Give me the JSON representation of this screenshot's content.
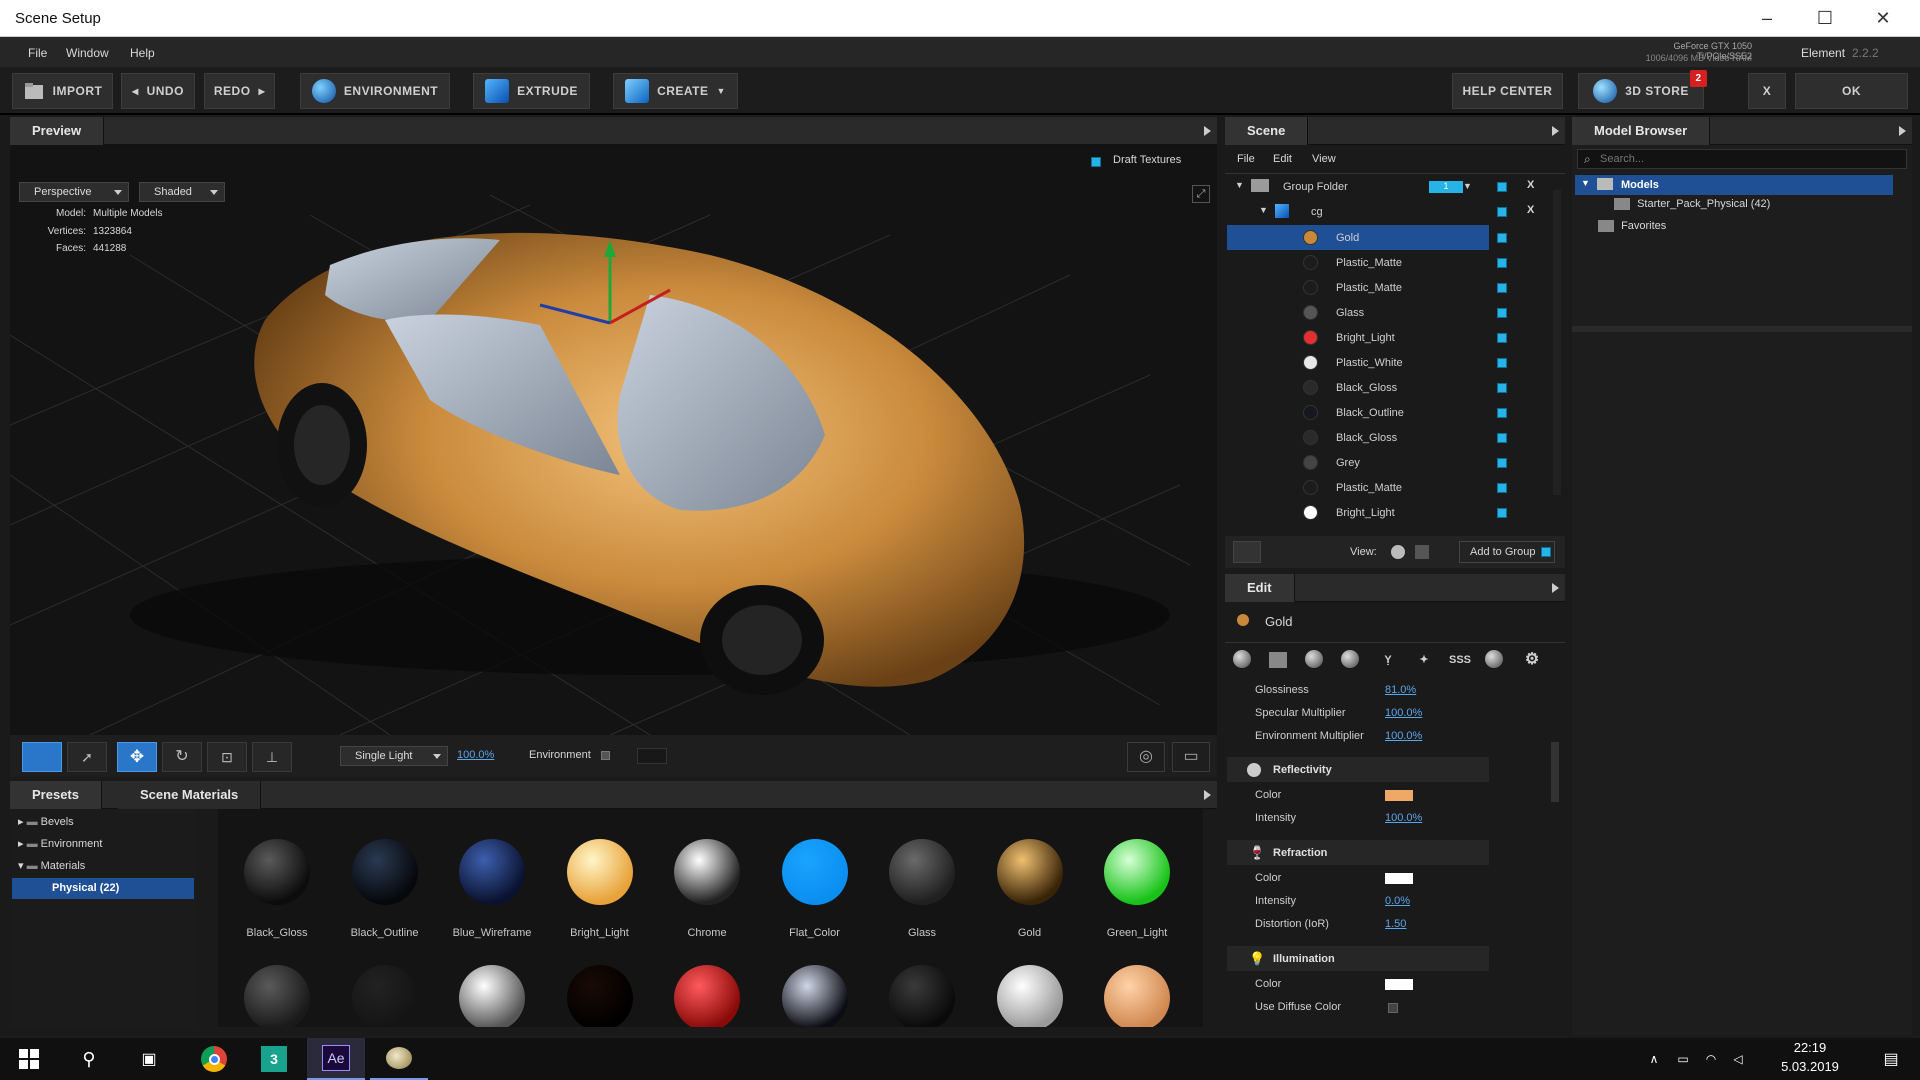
{
  "window": {
    "title": "Scene Setup"
  },
  "menu": {
    "file": "File",
    "window": "Window",
    "help": "Help",
    "gpu_line1": "GeForce GTX 1050 Ti/PCIe/SSE2",
    "gpu_line2": "1006/4096 MB Video RAM",
    "app_name": "Element",
    "app_version": "2.2.2"
  },
  "toolbar": {
    "import": "IMPORT",
    "undo": "UNDO",
    "redo": "REDO",
    "environment": "ENVIRONMENT",
    "extrude": "EXTRUDE",
    "create": "CREATE",
    "help_center": "HELP CENTER",
    "store": "3D STORE",
    "store_badge": "2",
    "close": "X",
    "ok": "OK"
  },
  "preview": {
    "title": "Preview",
    "draft_textures": "Draft Textures",
    "view_mode": "Perspective",
    "shading": "Shaded",
    "model_label": "Model:",
    "model_value": "Multiple Models",
    "vertices_label": "Vertices:",
    "vertices_value": "1323864",
    "faces_label": "Faces:",
    "faces_value": "441288",
    "light_mode": "Single Light",
    "light_intensity": "100.0%",
    "environment_label": "Environment"
  },
  "scene": {
    "title": "Scene",
    "menu_file": "File",
    "menu_edit": "Edit",
    "menu_view": "View",
    "group_folder": "Group Folder",
    "group_badge": "1",
    "close_x": "X",
    "child": "cg",
    "materials": [
      {
        "name": "Gold",
        "color": "#c88a3a",
        "selected": true
      },
      {
        "name": "Plastic_Matte",
        "color": "#1c1c1c"
      },
      {
        "name": "Plastic_Matte",
        "color": "#1c1c1c"
      },
      {
        "name": "Glass",
        "color": "#555555"
      },
      {
        "name": "Bright_Light",
        "color": "#e23030"
      },
      {
        "name": "Plastic_White",
        "color": "#e8e8e8"
      },
      {
        "name": "Black_Gloss",
        "color": "#2a2a2a"
      },
      {
        "name": "Black_Outline",
        "color": "#15181f"
      },
      {
        "name": "Black_Gloss",
        "color": "#2a2a2a"
      },
      {
        "name": "Grey",
        "color": "#444444"
      },
      {
        "name": "Plastic_Matte",
        "color": "#1c1c1c"
      },
      {
        "name": "Bright_Light",
        "color": "#ffffff"
      }
    ],
    "view_label": "View:",
    "add_to_group": "Add to Group"
  },
  "edit": {
    "title": "Edit",
    "material_name": "Gold",
    "params": [
      {
        "label": "Glossiness",
        "value": "81.0%"
      },
      {
        "label": "Specular Multiplier",
        "value": "100.0%"
      },
      {
        "label": "Environment Multiplier",
        "value": "100.0%"
      }
    ],
    "reflectivity": {
      "title": "Reflectivity",
      "color_label": "Color",
      "color": "#f0a866",
      "intensity_label": "Intensity",
      "intensity": "100.0%"
    },
    "refraction": {
      "title": "Refraction",
      "color_label": "Color",
      "color": "#ffffff",
      "intensity_label": "Intensity",
      "intensity": "0.0%",
      "distortion_label": "Distortion (IoR)",
      "distortion": "1.50"
    },
    "illumination": {
      "title": "Illumination",
      "color_label": "Color",
      "color": "#ffffff",
      "diffuse_label": "Use Diffuse Color"
    },
    "tab_icons": [
      "sphere-pair-icon",
      "texture-icon",
      "sphere-icon",
      "bump-icon",
      "wine-glass-icon",
      "bulb-icon",
      "sss-icon",
      "noise-icon",
      "gear-icon"
    ],
    "sss_text": "SSS"
  },
  "browser": {
    "title": "Model Browser",
    "search_placeholder": "Search...",
    "models": "Models",
    "starter": "Starter_Pack_Physical (42)",
    "favorites": "Favorites"
  },
  "presets": {
    "tab_presets": "Presets",
    "tab_scene": "Scene Materials",
    "folders": [
      "Bevels",
      "Environment",
      "Materials"
    ],
    "physical": "Physical (22)",
    "spheres": [
      {
        "name": "Black_Gloss",
        "c1": "#5a5a5a",
        "c2": "#0c0c0c"
      },
      {
        "name": "Black_Outline",
        "c1": "#2a3a52",
        "c2": "#06080c"
      },
      {
        "name": "Blue_Wireframe",
        "c1": "#3d5fae",
        "c2": "#0a1230"
      },
      {
        "name": "Bright_Light",
        "c1": "#fff6c8",
        "c2": "#e8a23a"
      },
      {
        "name": "Chrome",
        "c1": "#ffffff",
        "c2": "#222222"
      },
      {
        "name": "Flat_Color",
        "c1": "#1aa3ff",
        "c2": "#0a8ff0"
      },
      {
        "name": "Glass",
        "c1": "#6a6a6a",
        "c2": "#202020"
      },
      {
        "name": "Gold",
        "c1": "#f0c070",
        "c2": "#3a2408"
      },
      {
        "name": "Green_Light",
        "c1": "#d6ffd6",
        "c2": "#18c218"
      }
    ],
    "spheres_row2": [
      {
        "c1": "#5a5a5a",
        "c2": "#1a1a1a"
      },
      {
        "c1": "#222222",
        "c2": "#141414"
      },
      {
        "c1": "#ffffff",
        "c2": "#555555"
      },
      {
        "c1": "#1a0a04",
        "c2": "#000000"
      },
      {
        "c1": "#ff5a5a",
        "c2": "#8a0a0a"
      },
      {
        "c1": "#cfd6e6",
        "c2": "#0c0c14"
      },
      {
        "c1": "#3a3a3a",
        "c2": "#0a0a0a"
      },
      {
        "c1": "#ffffff",
        "c2": "#9a9a9a"
      },
      {
        "c1": "#ffd2a8",
        "c2": "#d08850"
      }
    ]
  },
  "taskbar": {
    "time": "22:19",
    "date": "5.03.2019"
  }
}
